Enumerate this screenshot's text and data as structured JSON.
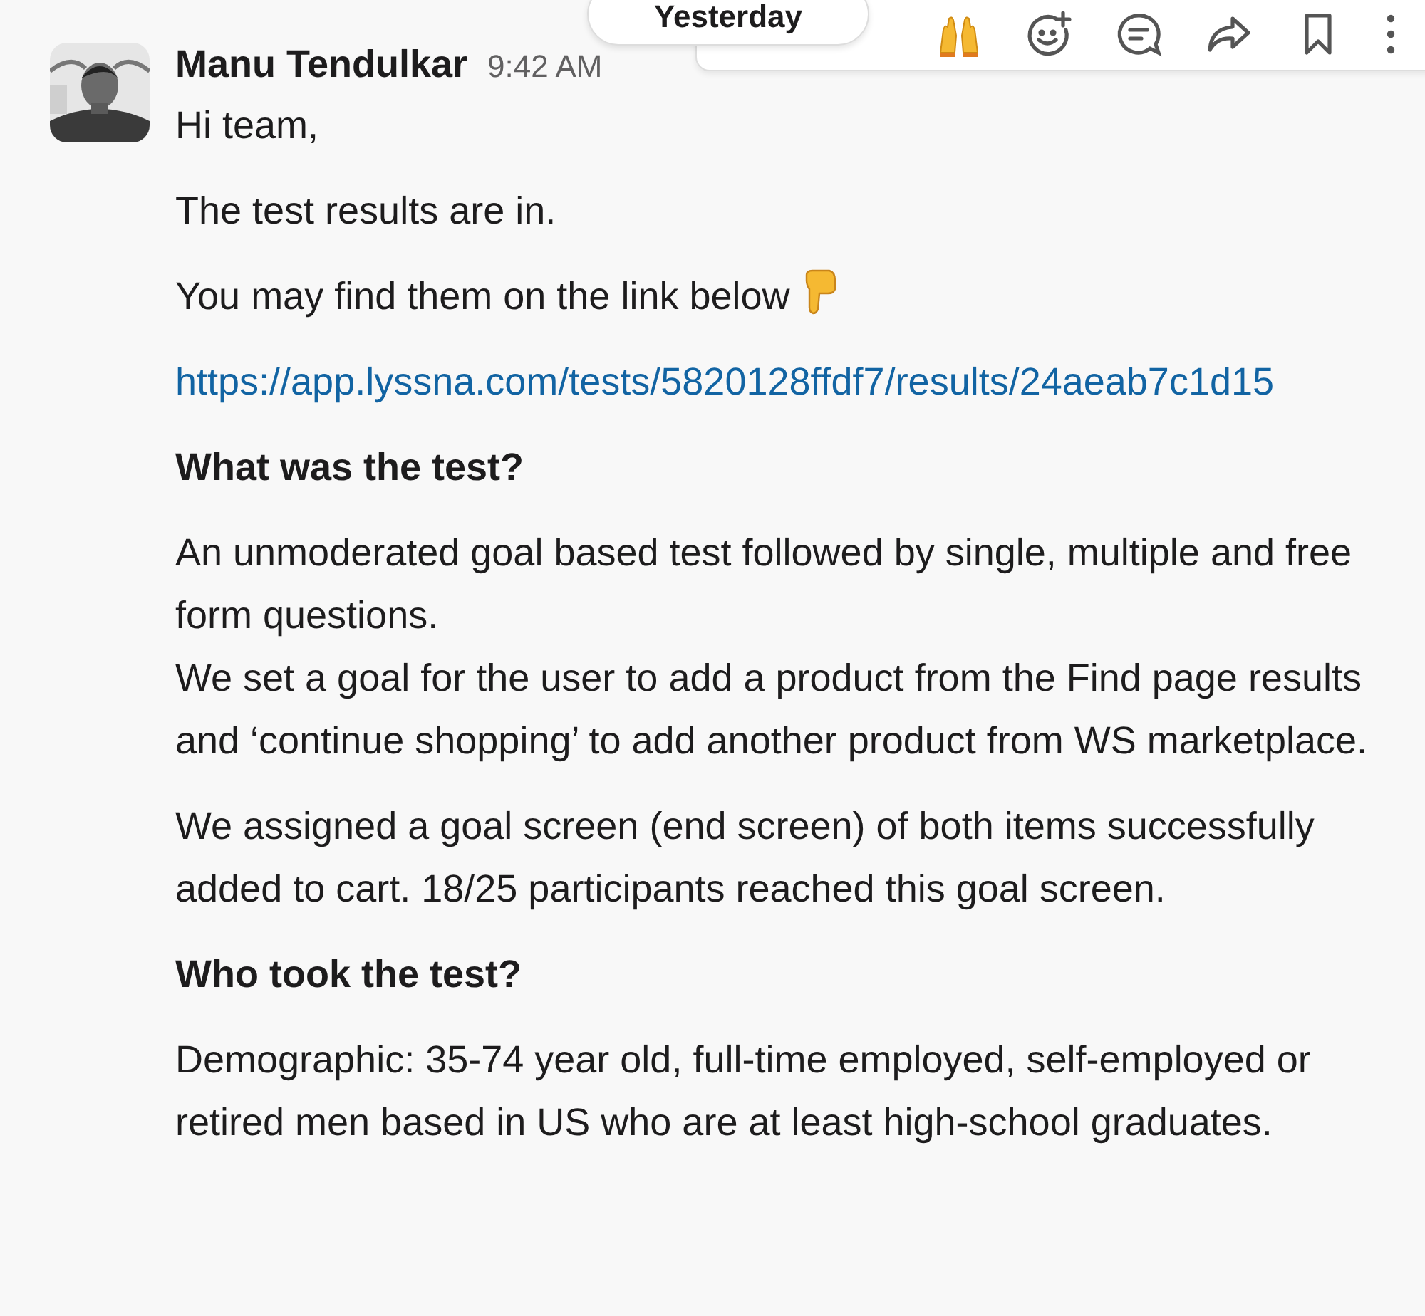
{
  "date_pill": {
    "label": "Yesterday"
  },
  "message": {
    "author": "Manu Tendulkar",
    "time": "9:42 AM",
    "blocks": [
      {
        "kind": "text",
        "lines": [
          "Hi team,"
        ]
      },
      {
        "kind": "text",
        "lines": [
          "The test results are in."
        ]
      },
      {
        "kind": "text_pointing",
        "lines": [
          "You may find them on the link below"
        ]
      },
      {
        "kind": "link",
        "lines": [
          "https://app.lyssna.com/tests/5820128ffdf7/results/24aeab7c1d15"
        ]
      },
      {
        "kind": "heading",
        "lines": [
          "What was the test?"
        ]
      },
      {
        "kind": "text",
        "lines": [
          "An unmoderated goal based test followed by single, multiple and free form questions.",
          "We set a goal for the user to add a product from the Find page results and ‘continue shopping’ to add another product from WS marketplace."
        ]
      },
      {
        "kind": "text",
        "lines": [
          "We assigned a goal screen (end screen) of both items successfully added to cart. 18/25 participants reached this goal screen."
        ]
      },
      {
        "kind": "heading",
        "lines": [
          "Who took the test?"
        ]
      },
      {
        "kind": "text",
        "lines": [
          "Demographic: 35-74 year old, full-time employed, self-employed or retired men based in US who are at least high-school graduates."
        ]
      }
    ]
  }
}
